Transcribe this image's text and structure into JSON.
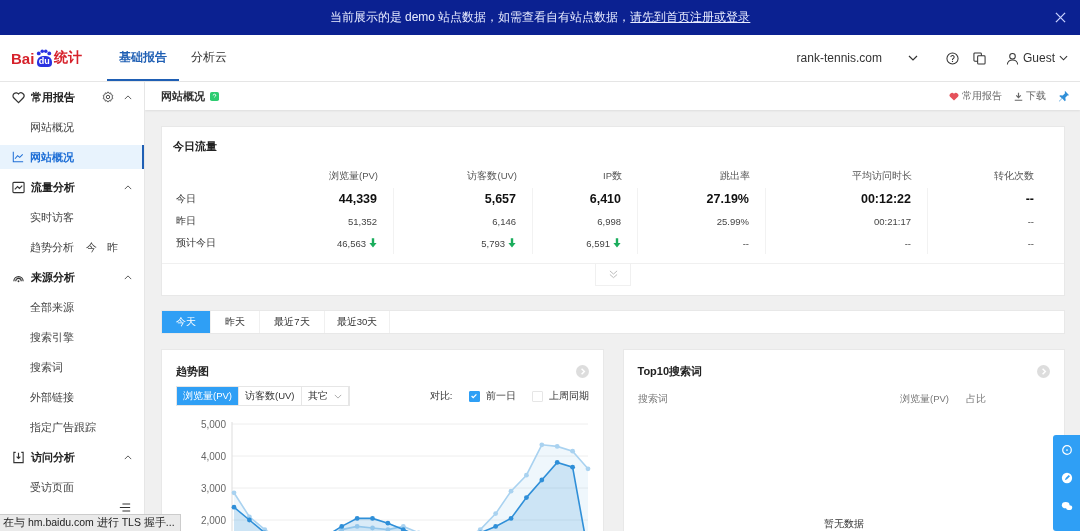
{
  "banner": {
    "text": "当前展示的是 demo 站点数据，如需查看自有站点数据，",
    "link": "请先到首页注册或登录"
  },
  "header": {
    "logo_text": "Bai",
    "logo_suffix": "统计",
    "logo_paw": "du",
    "nav": [
      {
        "label": "基础报告",
        "selected": true
      },
      {
        "label": "分析云",
        "selected": false
      }
    ],
    "site": "rank-tennis.com",
    "user": "Guest"
  },
  "sidebar": {
    "items": [
      {
        "kind": "group",
        "label": "常用报告",
        "expanded": true,
        "settings": true,
        "children": [
          {
            "label": "网站概况",
            "selected": false
          }
        ]
      },
      {
        "kind": "item",
        "label": "网站概况",
        "selected": true
      },
      {
        "kind": "group",
        "label": "流量分析",
        "expanded": true,
        "children": [
          {
            "label": "实时访客",
            "selected": false
          },
          {
            "label": "趋势分析",
            "selected": false,
            "extras": [
              "今",
              "昨"
            ]
          }
        ]
      },
      {
        "kind": "group",
        "label": "来源分析",
        "expanded": true,
        "children": [
          {
            "label": "全部来源",
            "selected": false
          },
          {
            "label": "搜索引擎",
            "selected": false
          },
          {
            "label": "搜索词",
            "selected": false
          },
          {
            "label": "外部链接",
            "selected": false
          },
          {
            "label": "指定广告跟踪",
            "selected": false
          }
        ]
      },
      {
        "kind": "group",
        "label": "访问分析",
        "expanded": true,
        "children": [
          {
            "label": "受访页面",
            "selected": false
          }
        ]
      }
    ]
  },
  "page_header": {
    "title": "网站概况",
    "actions": [
      "常用报告",
      "下载"
    ]
  },
  "today_traffic": {
    "title": "今日流量",
    "columns": [
      "浏览量(PV)",
      "访客数(UV)",
      "IP数",
      "跳出率",
      "平均访问时长",
      "转化次数"
    ],
    "rows": [
      {
        "kind": "today",
        "label": "今日",
        "cells": [
          {
            "value": "44,339"
          },
          {
            "value": "5,657"
          },
          {
            "value": "6,410"
          },
          {
            "value": "27.19%"
          },
          {
            "value": "00:12:22"
          },
          {
            "value": "--"
          }
        ]
      },
      {
        "kind": "other",
        "label": "昨日",
        "cells": [
          {
            "value": "51,352"
          },
          {
            "value": "6,146"
          },
          {
            "value": "6,998"
          },
          {
            "value": "25.99%"
          },
          {
            "value": "00:21:17"
          },
          {
            "value": "--"
          }
        ]
      },
      {
        "kind": "other",
        "label": "预计今日",
        "cells": [
          {
            "value": "46,563",
            "decrease": true
          },
          {
            "value": "5,793",
            "decrease": true
          },
          {
            "value": "6,591",
            "decrease": true
          },
          {
            "value": "--"
          },
          {
            "value": "--"
          },
          {
            "value": "--"
          }
        ]
      }
    ]
  },
  "period_tabs": [
    {
      "label": "今天",
      "selected": true
    },
    {
      "label": "昨天",
      "selected": false
    },
    {
      "label": "最近7天",
      "selected": false
    },
    {
      "label": "最近30天",
      "selected": false
    }
  ],
  "trend": {
    "title": "趋势图",
    "metrics": [
      {
        "label": "浏览量(PV)",
        "selected": true
      },
      {
        "label": "访客数(UV)",
        "selected": false
      },
      {
        "label": "其它",
        "selected": false,
        "dropdown": true
      }
    ],
    "compare_label": "对比:",
    "compare": [
      {
        "label": "前一日",
        "checked": true
      },
      {
        "label": "上周同期",
        "checked": false
      }
    ],
    "chart_data": {
      "type": "area",
      "grid": true,
      "ylim": [
        0,
        5000
      ],
      "yticks": [
        {
          "value": 2000,
          "label": "2,000"
        },
        {
          "value": 3000,
          "label": "3,000"
        },
        {
          "value": 4000,
          "label": "4,000"
        },
        {
          "value": 5000,
          "label": "5,000"
        }
      ],
      "series": [
        {
          "color": "#2f8fd8",
          "values": [
            2400,
            2000,
            1600,
            1300,
            1100,
            1200,
            1500,
            1800,
            2050,
            2050,
            1900,
            1700,
            1500,
            1400,
            1400,
            1500,
            1600,
            1800,
            2050,
            2700,
            3250,
            3800,
            3650,
            1000
          ]
        },
        {
          "color": "#a9d2f0",
          "values": [
            2850,
            2100,
            1700,
            1400,
            1200,
            1200,
            1400,
            1700,
            1800,
            1750,
            1700,
            1800,
            1600,
            1400,
            1300,
            1400,
            1700,
            2200,
            2900,
            3400,
            4350,
            4300,
            4150,
            3600
          ]
        }
      ]
    }
  },
  "top_search": {
    "title": "Top10搜索词",
    "columns": [
      "搜索词",
      "浏览量(PV)",
      "占比"
    ],
    "empty_text": "暂无数据"
  },
  "status_bar": "在与 hm.baidu.com 进行 TLS 握手..."
}
